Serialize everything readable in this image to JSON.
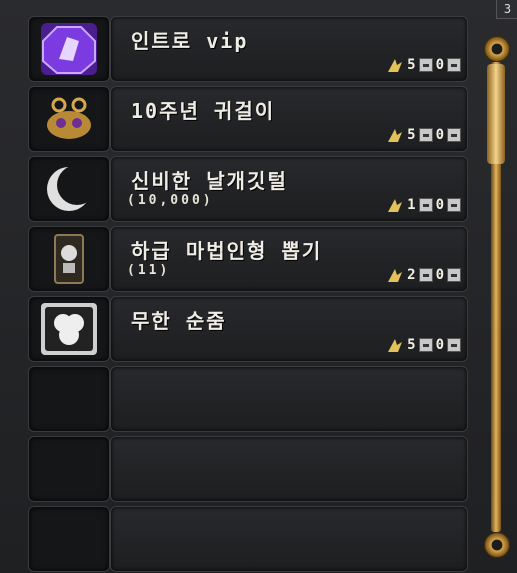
{
  "window": {
    "corner_label": "3"
  },
  "items": [
    {
      "name": "인트로 vip",
      "qty": "",
      "count": "5",
      "value": "0",
      "icon": "purple-emblem-icon"
    },
    {
      "name": "10주년 귀걸이",
      "qty": "",
      "count": "5",
      "value": "0",
      "icon": "gold-earring-icon"
    },
    {
      "name": "신비한 날개깃털",
      "qty": "(10,000)",
      "count": "1",
      "value": "0",
      "icon": "feather-icon"
    },
    {
      "name": "하급 마법인형 뽑기",
      "qty": "(11)",
      "count": "2",
      "value": "0",
      "icon": "doll-box-icon"
    },
    {
      "name": "무한 순줌",
      "qty": "",
      "count": "5",
      "value": "0",
      "icon": "white-scroll-icon"
    },
    {
      "name": "",
      "qty": "",
      "count": "",
      "value": "",
      "icon": ""
    },
    {
      "name": "",
      "qty": "",
      "count": "",
      "value": "",
      "icon": ""
    },
    {
      "name": "",
      "qty": "",
      "count": "",
      "value": "",
      "icon": ""
    }
  ],
  "colors": {
    "accent_gold": "#d7a74b",
    "panel_bg": "#1f2022"
  }
}
